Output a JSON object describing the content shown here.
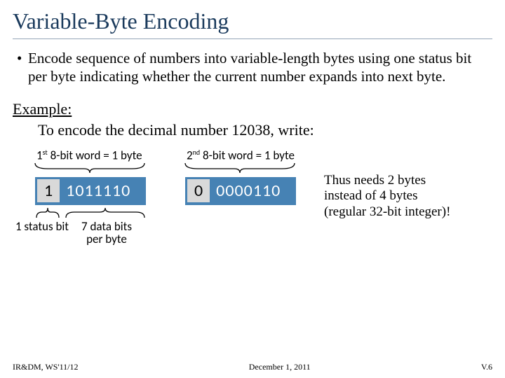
{
  "title": "Variable-Byte Encoding",
  "bullet": "Encode sequence of numbers into variable-length bytes using one status bit per byte indicating whether the current number expands into next byte.",
  "example_label": "Example:",
  "example_line": "To encode the decimal number 12038, write:",
  "word1": {
    "label_pre": "1",
    "label_sup": "st",
    "label_post": " 8-bit word = 1 byte",
    "status": "1",
    "data": "1011110"
  },
  "word2": {
    "label_pre": "2",
    "label_sup": "nd",
    "label_post": " 8-bit word = 1 byte",
    "status": "0",
    "data": "0000110"
  },
  "status_caption": "1 status bit",
  "data_caption_l1": "7 data bits",
  "data_caption_l2": "per byte",
  "conclusion_l1": "Thus needs 2 bytes",
  "conclusion_l2": "instead of 4 bytes",
  "conclusion_l3": "(regular 32-bit integer)!",
  "footer": {
    "left": "IR&DM, WS'11/12",
    "center": "December 1, 2011",
    "right": "V.6"
  }
}
